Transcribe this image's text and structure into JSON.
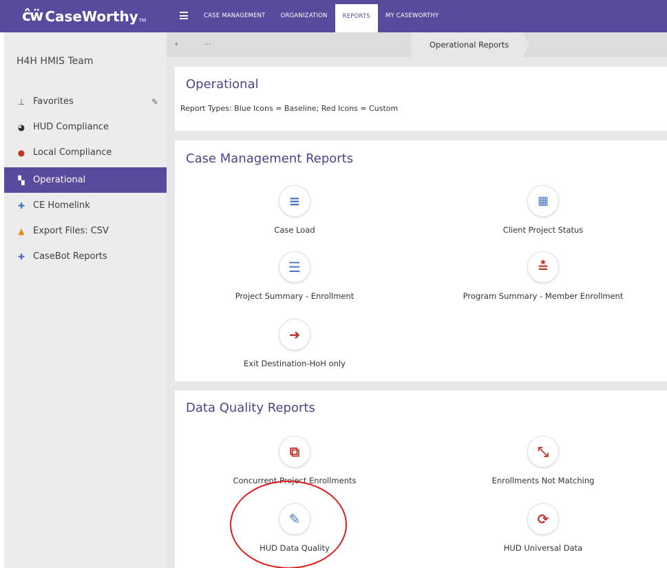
{
  "brand": {
    "glyph": "ĉẅ",
    "name": "CaseWorthy",
    "tm": "TM"
  },
  "topnav": [
    {
      "label": "CASE MANAGEMENT"
    },
    {
      "label": "ORGANIZATION"
    },
    {
      "label": "REPORTS"
    },
    {
      "label": "MY CASEWORTHY"
    }
  ],
  "sidebar": {
    "team": "H4H HMIS Team",
    "items": [
      {
        "label": "Favorites",
        "icon": "pin-icon",
        "glyph": "📌"
      },
      {
        "label": "HUD Compliance",
        "icon": "dashboard-icon",
        "glyph": "◕"
      },
      {
        "label": "Local Compliance",
        "icon": "map-marker-icon",
        "glyph": "●"
      },
      {
        "label": "Operational",
        "icon": "document-icon",
        "glyph": "▚"
      },
      {
        "label": "CE Homelink",
        "icon": "plus-icon",
        "glyph": "✚"
      },
      {
        "label": "Export Files: CSV",
        "icon": "upload-icon",
        "glyph": "▲"
      },
      {
        "label": "CaseBot Reports",
        "icon": "plus-icon",
        "glyph": "✚"
      }
    ]
  },
  "breadcrumb": {
    "back": "‹",
    "ellipsis": "...",
    "current": "Operational Reports"
  },
  "operational": {
    "title": "Operational",
    "note": "Report Types: Blue Icons = Baseline; Red Icons = Custom"
  },
  "case_management": {
    "title": "Case Management Reports",
    "reports": [
      {
        "label": "Case Load",
        "icon": "numbered-list-icon",
        "glyph": "≡"
      },
      {
        "label": "Client Project Status",
        "icon": "qr-code-icon",
        "glyph": "▦"
      },
      {
        "label": "Project Summary - Enrollment",
        "icon": "list-icon",
        "glyph": "☰"
      },
      {
        "label": "Program Summary - Member Enrollment",
        "icon": "strikethrough-icon",
        "glyph": "≛"
      },
      {
        "label": "Exit Destination-HoH only",
        "icon": "arrow-right-icon",
        "glyph": "➜"
      }
    ]
  },
  "data_quality": {
    "title": "Data Quality Reports",
    "reports": [
      {
        "label": "Concurrent Project Enrollments",
        "icon": "copy-icon",
        "glyph": "⧉"
      },
      {
        "label": "Enrollments Not Matching",
        "icon": "compress-icon",
        "glyph": "⤡"
      },
      {
        "label": "HUD Data Quality",
        "icon": "edit-icon",
        "glyph": "✎"
      },
      {
        "label": "HUD Universal Data",
        "icon": "refresh-icon",
        "glyph": "⟳"
      }
    ]
  },
  "colors": {
    "brand": "#5a4a9e",
    "baseline_icon": "#4a74c2",
    "custom_icon": "#c0392b",
    "annotation": "#e01b1b"
  }
}
